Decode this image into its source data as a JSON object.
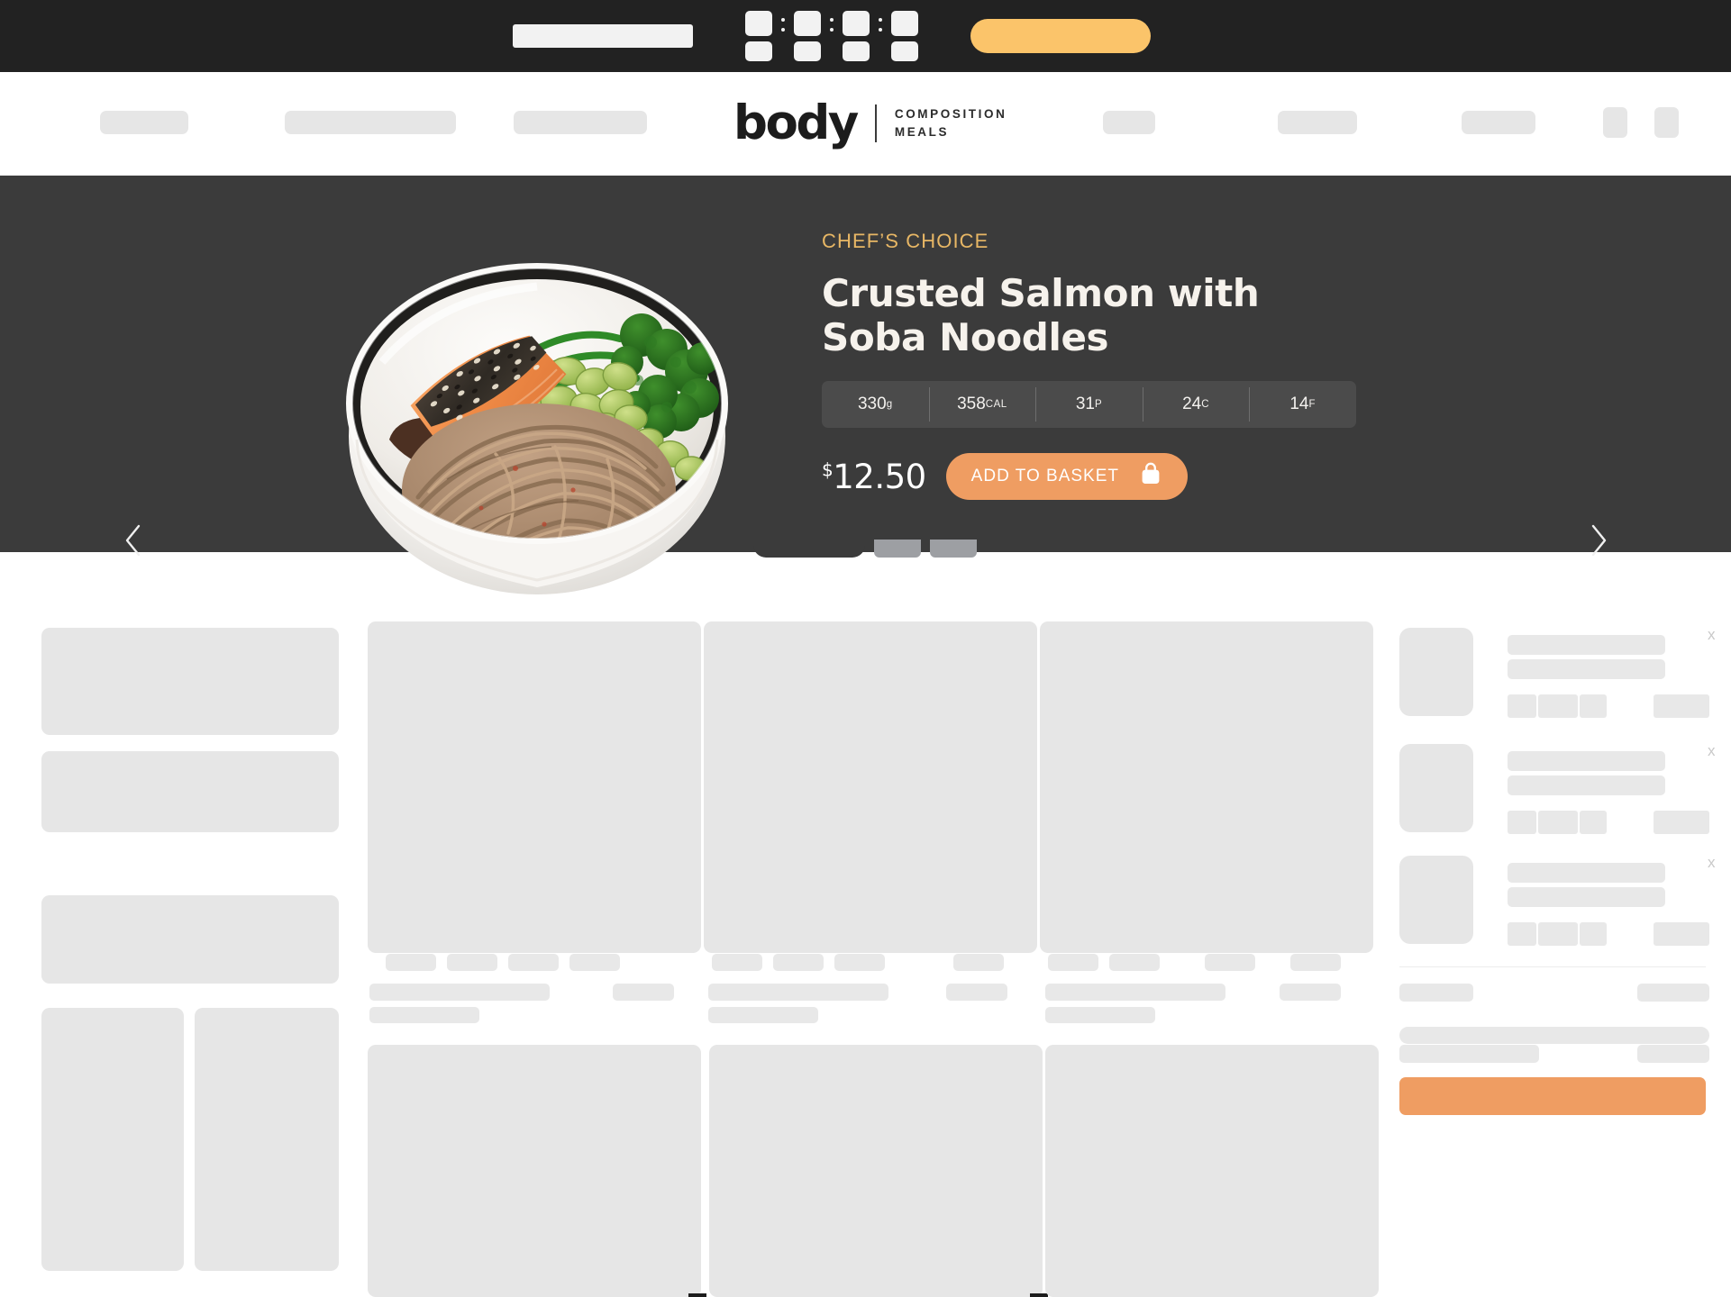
{
  "topbar": {
    "promo_text_placeholder": "",
    "timer_segments": [
      "",
      "",
      "",
      ""
    ],
    "separator": ":",
    "cta_label": "",
    "cta_color": "#fbc46a",
    "background": "#222222"
  },
  "nav": {
    "logo": {
      "word": "body",
      "subtitle_line1": "COMPOSITION",
      "subtitle_line2": "MEALS"
    },
    "left_items": [
      "",
      "",
      ""
    ],
    "right_items": [
      "",
      "",
      ""
    ],
    "icons": [
      "search-icon",
      "account-icon"
    ]
  },
  "hero": {
    "eyebrow": "CHEF’S CHOICE",
    "title_line1": "Crusted Salmon with",
    "title_line2": "Soba Noodles",
    "nutrition": [
      {
        "value": "330",
        "unit": "g"
      },
      {
        "value": "358",
        "unit": "CAL"
      },
      {
        "value": "31",
        "unit": "P"
      },
      {
        "value": "24",
        "unit": "C"
      },
      {
        "value": "14",
        "unit": "F"
      }
    ],
    "currency_symbol": "$",
    "price": "12.50",
    "add_to_basket_label": "ADD TO BASKET",
    "basket_icon": "shopping-bag-icon",
    "prev_icon": "chevron-left-icon",
    "next_icon": "chevron-right-icon",
    "background": "#3b3b3b",
    "eyebrow_color": "#e8b765",
    "button_color": "#ef9d62",
    "dish_image_alt": "Crusted salmon fillet with soba noodles, edamame and tenderstem broccoli in a white bowl"
  },
  "tabs": {
    "active_index": 0,
    "labels": [
      "",
      "",
      ""
    ]
  },
  "filters": {
    "blocks": [
      "",
      "",
      "",
      "",
      ""
    ]
  },
  "product_grid": {
    "columns": 3,
    "cards": [
      "",
      "",
      "",
      "",
      "",
      ""
    ]
  },
  "cart": {
    "items": [
      {
        "name": "",
        "meta": "",
        "remove_label": "x"
      },
      {
        "name": "",
        "meta": "",
        "remove_label": "x"
      },
      {
        "name": "",
        "meta": "",
        "remove_label": "x"
      }
    ],
    "summary_rows": [
      "",
      "",
      ""
    ],
    "checkout_label": "",
    "checkout_color": "#ef9d62"
  },
  "colors": {
    "skeleton": "#e6e6e6",
    "skeleton_light": "#e8e8e8",
    "dark": "#3b3b3b",
    "accent_orange": "#ef9d62",
    "accent_yellow": "#fbc46a"
  }
}
